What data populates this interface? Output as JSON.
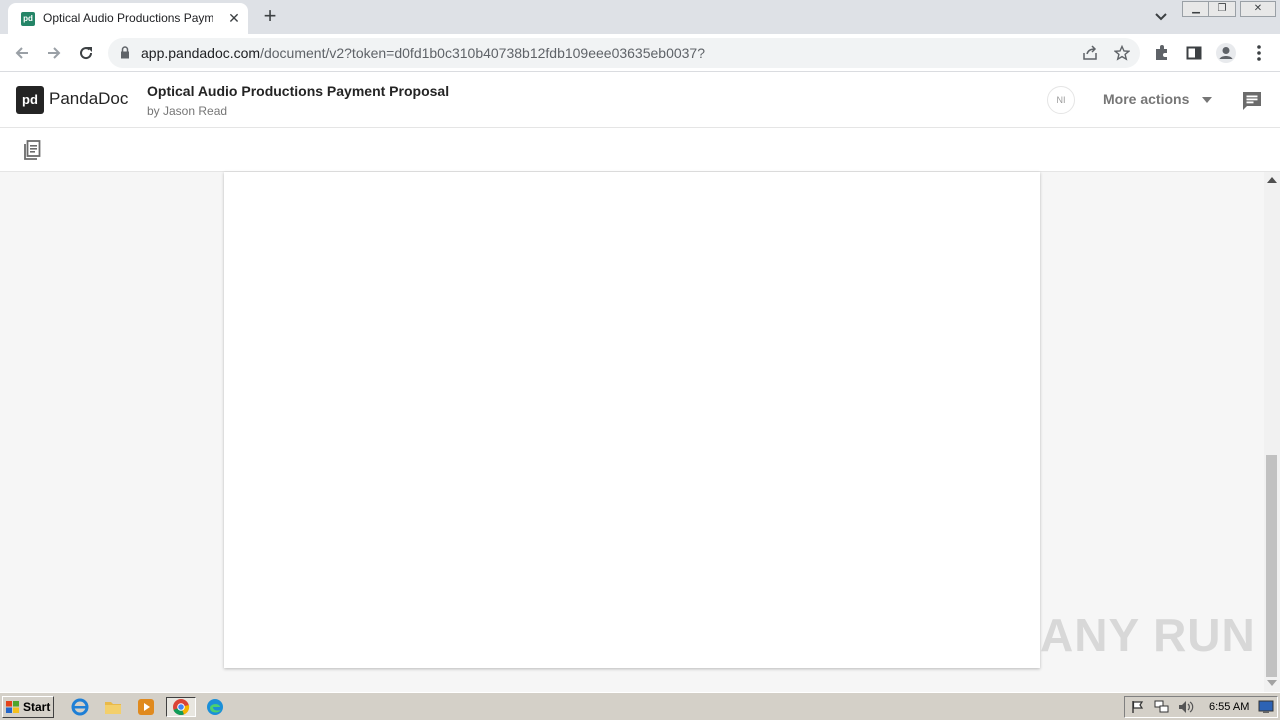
{
  "browser": {
    "tab_title": "Optical Audio Productions Payment Proposal",
    "url_host": "app.pandadoc.com",
    "url_path": "/document/v2?token=d0fd1b0c310b40738b12fdb109eee03635eb0037?",
    "icons": [
      "back-arrow-icon",
      "forward-arrow-icon",
      "reload-icon",
      "lock-icon",
      "share-icon",
      "star-icon",
      "extension-icon",
      "side-panel-icon",
      "profile-icon",
      "kebab-menu-icon"
    ]
  },
  "app": {
    "brand": "PandaDoc",
    "logo_mark": "pd",
    "document_title": "Optical Audio Productions Payment Proposal",
    "author": "by Jason Read",
    "avatar_initials": "NI",
    "more_actions_label": "More actions",
    "brand_color": "#248567"
  },
  "watermark": "ANY RUN",
  "taskbar": {
    "start_label": "Start",
    "clock": "6:55 AM"
  }
}
